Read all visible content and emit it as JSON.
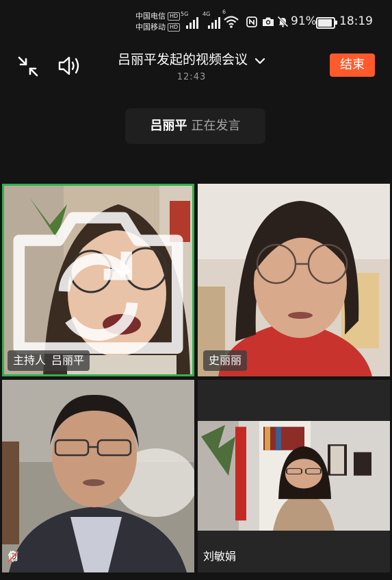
{
  "status_bar": {
    "carrier1": "中国电信",
    "carrier2": "中国移动",
    "hd_badge": "HD",
    "net1": "5G",
    "net2": "4G",
    "wifi_label": "6",
    "battery": "91%",
    "battery_level": 0.91,
    "time": "18:19",
    "icons": [
      "nfc-icon",
      "camera-icon",
      "mute-bell-icon"
    ]
  },
  "header": {
    "title": "吕丽平发起的视频会议",
    "duration": "12:43",
    "end_label": "结束"
  },
  "speaking": {
    "name": "吕丽平",
    "status": "正在发言"
  },
  "participants": [
    {
      "role": "主持人",
      "name": "吕丽平",
      "active": true,
      "muted": false
    },
    {
      "role": "",
      "name": "史丽丽",
      "active": false,
      "muted": false
    },
    {
      "role": "",
      "name": "何",
      "active": false,
      "muted": true
    },
    {
      "role": "",
      "name": "刘敏娟",
      "active": false,
      "muted": false
    }
  ],
  "colors": {
    "background": "#141414",
    "end_button": "#ff5a2b",
    "active_speaker_border": "#2fb24c"
  }
}
